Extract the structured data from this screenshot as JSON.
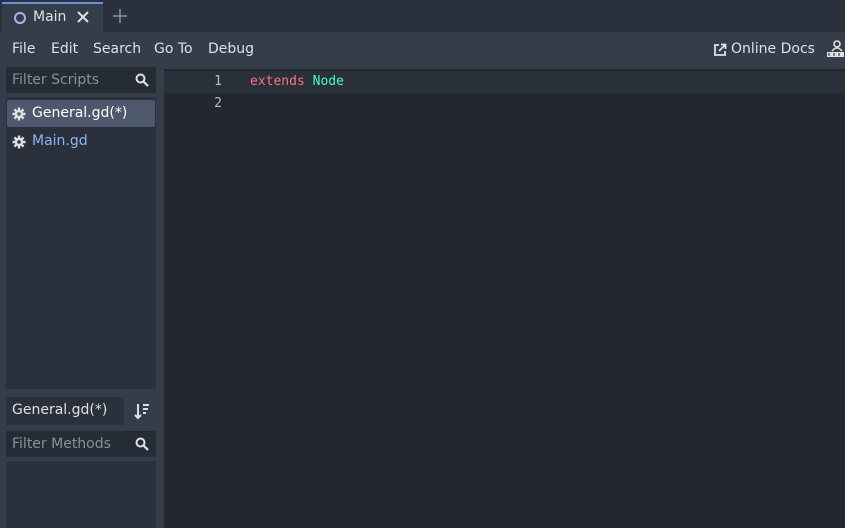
{
  "tabs": [
    {
      "label": "Main",
      "icon": "circle-icon",
      "active": true
    }
  ],
  "menu": [
    {
      "label": "File"
    },
    {
      "label": "Edit"
    },
    {
      "label": "Search"
    },
    {
      "label": "Go To"
    },
    {
      "label": "Debug"
    }
  ],
  "online_docs": {
    "label": "Online Docs",
    "icon": "external-link-icon"
  },
  "scripts": {
    "filter_placeholder": "Filter Scripts",
    "items": [
      {
        "label": "General.gd(*)",
        "icon": "gear-icon",
        "selected": true
      },
      {
        "label": "Main.gd",
        "icon": "gear-icon",
        "selected": false
      }
    ]
  },
  "methods": {
    "current_script": "General.gd(*)",
    "filter_placeholder": "Filter Methods"
  },
  "editor": {
    "lines": [
      {
        "number": "1",
        "keyword": "extends",
        "type": "Node"
      },
      {
        "number": "2",
        "keyword": "",
        "type": ""
      }
    ]
  },
  "colors": {
    "accent": "#6d8fd9",
    "keyword": "#ff7085",
    "type": "#42ffc2",
    "selected_item_text": "#ffffff",
    "item_text": "#8eb4f5"
  }
}
